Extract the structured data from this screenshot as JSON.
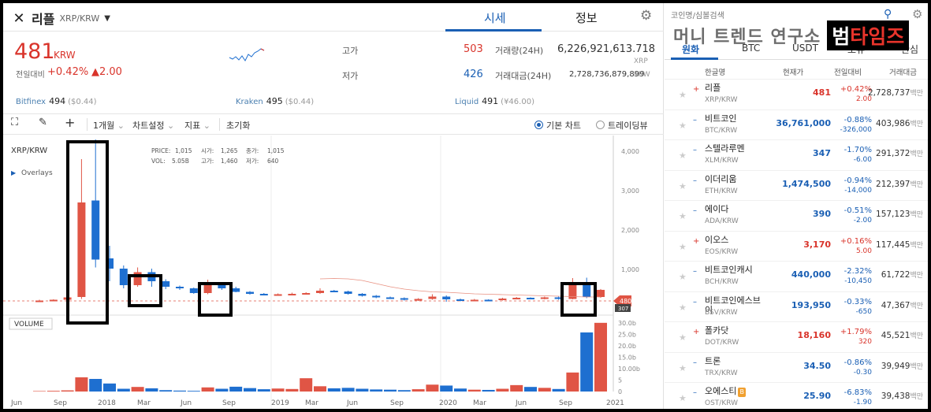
{
  "header": {
    "coin_kr": "리플",
    "pair": "XRP/KRW",
    "tab_market": "시세",
    "tab_info": "정보"
  },
  "price": {
    "current": "481",
    "unit": "KRW",
    "change_label": "전일대비",
    "change_pct": "+0.42%",
    "change_abs": "▲2.00",
    "high_label": "고가",
    "high": "503",
    "low_label": "저가",
    "low": "426",
    "volume_label": "거래량(24H)",
    "volume": "6,226,921,613.718",
    "volume_unit": "XRP",
    "amount_label": "거래대금(24H)",
    "amount": "2,728,736,879,899",
    "amount_unit": "KRW"
  },
  "exchanges": [
    {
      "name": "Bitfinex",
      "value": "494",
      "sub": "($0.44)"
    },
    {
      "name": "Kraken",
      "value": "495",
      "sub": "($0.44)"
    },
    {
      "name": "Liquid",
      "value": "491",
      "sub": "(¥46.00)"
    }
  ],
  "toolbar": {
    "period": "1개월",
    "chart_settings": "차트설정",
    "indicators": "지표",
    "reset": "초기화",
    "basic_chart": "기본 차트",
    "tradingview": "트레이딩뷰"
  },
  "chart_info": {
    "symbol": "XRP/KRW",
    "overlays": "Overlays",
    "price_label": "PRICE:",
    "price": "1,015",
    "open_label": "시가:",
    "open": "1,265",
    "close_label": "종가:",
    "close": "1,015",
    "vol_label": "VOL:",
    "vol": "5.05B",
    "high_label": "고가:",
    "high": "1,460",
    "low_label": "저가:",
    "low": "640",
    "volume_title": "VOLUME",
    "last_price_tag": "480",
    "last_price_sub": "307"
  },
  "chart_data": {
    "type": "candlestick",
    "x_ticks": [
      "Jun",
      "Sep",
      "2018",
      "Mar",
      "Jun",
      "Sep",
      "2019",
      "Mar",
      "Jun",
      "Sep",
      "2020",
      "Mar",
      "Jun",
      "Sep",
      "2021"
    ],
    "y_ticks": [
      "4,000",
      "3,000",
      "2,000",
      "1,000",
      "0"
    ],
    "ylim": [
      0,
      4400
    ],
    "vol_ticks": [
      "30.0b",
      "25.0b",
      "20.0b",
      "15.0b",
      "10.00b",
      "5",
      "0"
    ],
    "vol_lim": [
      0,
      32
    ],
    "up_color": "#e05545",
    "down_color": "#1e6fd0",
    "candles": [
      {
        "o": 200,
        "c": 210,
        "h": 230,
        "l": 190,
        "up": true,
        "v": 0.2
      },
      {
        "o": 210,
        "c": 230,
        "h": 240,
        "l": 200,
        "up": true,
        "v": 0.3
      },
      {
        "o": 230,
        "c": 290,
        "h": 320,
        "l": 215,
        "up": true,
        "v": 0.5
      },
      {
        "o": 300,
        "c": 2700,
        "h": 3800,
        "l": 250,
        "up": true,
        "v": 6.2
      },
      {
        "o": 2750,
        "c": 1250,
        "h": 4300,
        "l": 1050,
        "up": false,
        "v": 5.5
      },
      {
        "o": 1280,
        "c": 1020,
        "h": 1600,
        "l": 700,
        "up": false,
        "v": 3.5
      },
      {
        "o": 1020,
        "c": 600,
        "h": 1100,
        "l": 520,
        "up": false,
        "v": 1.2
      },
      {
        "o": 600,
        "c": 930,
        "h": 1050,
        "l": 560,
        "up": true,
        "v": 2.0
      },
      {
        "o": 930,
        "c": 700,
        "h": 1020,
        "l": 560,
        "up": false,
        "v": 1.4
      },
      {
        "o": 700,
        "c": 560,
        "h": 750,
        "l": 500,
        "up": false,
        "v": 0.6
      },
      {
        "o": 560,
        "c": 520,
        "h": 590,
        "l": 480,
        "up": false,
        "v": 0.4
      },
      {
        "o": 520,
        "c": 400,
        "h": 540,
        "l": 380,
        "up": false,
        "v": 0.3
      },
      {
        "o": 400,
        "c": 620,
        "h": 740,
        "l": 370,
        "up": true,
        "v": 1.8
      },
      {
        "o": 620,
        "c": 520,
        "h": 680,
        "l": 480,
        "up": false,
        "v": 1.2
      },
      {
        "o": 520,
        "c": 430,
        "h": 560,
        "l": 420,
        "up": false,
        "v": 2.1
      },
      {
        "o": 430,
        "c": 380,
        "h": 450,
        "l": 360,
        "up": false,
        "v": 1.5
      },
      {
        "o": 380,
        "c": 360,
        "h": 400,
        "l": 340,
        "up": false,
        "v": 1.0
      },
      {
        "o": 360,
        "c": 370,
        "h": 390,
        "l": 340,
        "up": true,
        "v": 1.3
      },
      {
        "o": 370,
        "c": 380,
        "h": 410,
        "l": 350,
        "up": true,
        "v": 1.1
      },
      {
        "o": 380,
        "c": 400,
        "h": 420,
        "l": 360,
        "up": true,
        "v": 5.8
      },
      {
        "o": 400,
        "c": 460,
        "h": 520,
        "l": 380,
        "up": true,
        "v": 2.3
      },
      {
        "o": 460,
        "c": 440,
        "h": 480,
        "l": 420,
        "up": false,
        "v": 1.4
      },
      {
        "o": 440,
        "c": 380,
        "h": 460,
        "l": 360,
        "up": false,
        "v": 1.6
      },
      {
        "o": 380,
        "c": 330,
        "h": 400,
        "l": 310,
        "up": false,
        "v": 1.2
      },
      {
        "o": 330,
        "c": 290,
        "h": 350,
        "l": 270,
        "up": false,
        "v": 0.9
      },
      {
        "o": 290,
        "c": 270,
        "h": 310,
        "l": 250,
        "up": false,
        "v": 0.8
      },
      {
        "o": 270,
        "c": 230,
        "h": 290,
        "l": 210,
        "up": false,
        "v": 0.6
      },
      {
        "o": 230,
        "c": 250,
        "h": 270,
        "l": 200,
        "up": true,
        "v": 1.0
      },
      {
        "o": 250,
        "c": 310,
        "h": 370,
        "l": 230,
        "up": true,
        "v": 3.0
      },
      {
        "o": 310,
        "c": 240,
        "h": 340,
        "l": 180,
        "up": false,
        "v": 2.6
      },
      {
        "o": 240,
        "c": 210,
        "h": 260,
        "l": 190,
        "up": false,
        "v": 1.3
      },
      {
        "o": 210,
        "c": 230,
        "h": 250,
        "l": 190,
        "up": true,
        "v": 0.8
      },
      {
        "o": 230,
        "c": 220,
        "h": 240,
        "l": 200,
        "up": false,
        "v": 0.7
      },
      {
        "o": 220,
        "c": 260,
        "h": 280,
        "l": 210,
        "up": true,
        "v": 1.2
      },
      {
        "o": 260,
        "c": 280,
        "h": 300,
        "l": 240,
        "up": true,
        "v": 2.8
      },
      {
        "o": 280,
        "c": 260,
        "h": 290,
        "l": 240,
        "up": false,
        "v": 2.0
      },
      {
        "o": 260,
        "c": 290,
        "h": 310,
        "l": 240,
        "up": true,
        "v": 1.6
      },
      {
        "o": 290,
        "c": 250,
        "h": 310,
        "l": 230,
        "up": false,
        "v": 1.1
      },
      {
        "o": 250,
        "c": 640,
        "h": 780,
        "l": 240,
        "up": true,
        "v": 8.3
      },
      {
        "o": 640,
        "c": 300,
        "h": 790,
        "l": 270,
        "up": false,
        "v": 25.8
      },
      {
        "o": 300,
        "c": 481,
        "h": 503,
        "l": 280,
        "up": true,
        "v": 30.0
      }
    ],
    "ma_line": [
      null,
      null,
      null,
      null,
      null,
      null,
      null,
      null,
      null,
      null,
      null,
      null,
      null,
      null,
      null,
      null,
      null,
      null,
      null,
      null,
      760,
      770,
      760,
      720,
      640,
      560,
      500,
      460,
      430,
      420,
      400,
      380,
      370,
      360,
      350,
      340,
      330,
      320,
      310,
      300,
      300
    ]
  },
  "right_panel": {
    "search_placeholder": "코인명/심볼검색",
    "tabs": [
      "원화",
      "BTC",
      "USDT",
      "보유",
      "관심"
    ],
    "headers": [
      "한글명",
      "현재가",
      "전일대비",
      "거래대금"
    ],
    "volume_unit": "백만",
    "rows": [
      {
        "name": "리플",
        "symbol": "XRP/KRW",
        "price": "481",
        "pct": "+0.42%",
        "diff": "2.00",
        "vol": "2,728,737",
        "dir": "up"
      },
      {
        "name": "비트코인",
        "symbol": "BTC/KRW",
        "price": "36,761,000",
        "pct": "-0.88%",
        "diff": "-326,000",
        "vol": "403,986",
        "dir": "dn"
      },
      {
        "name": "스텔라루멘",
        "symbol": "XLM/KRW",
        "price": "347",
        "pct": "-1.70%",
        "diff": "-6.00",
        "vol": "291,372",
        "dir": "dn"
      },
      {
        "name": "이더리움",
        "symbol": "ETH/KRW",
        "price": "1,474,500",
        "pct": "-0.94%",
        "diff": "-14,000",
        "vol": "212,397",
        "dir": "dn"
      },
      {
        "name": "에이다",
        "symbol": "ADA/KRW",
        "price": "390",
        "pct": "-0.51%",
        "diff": "-2.00",
        "vol": "157,123",
        "dir": "dn"
      },
      {
        "name": "이오스",
        "symbol": "EOS/KRW",
        "price": "3,170",
        "pct": "+0.16%",
        "diff": "5.00",
        "vol": "117,445",
        "dir": "up"
      },
      {
        "name": "비트코인캐시",
        "symbol": "BCH/KRW",
        "price": "440,000",
        "pct": "-2.32%",
        "diff": "-10,450",
        "vol": "61,722",
        "dir": "dn"
      },
      {
        "name": "비트코인에스브이",
        "symbol": "BSV/KRW",
        "price": "193,950",
        "pct": "-0.33%",
        "diff": "-650",
        "vol": "47,367",
        "dir": "dn"
      },
      {
        "name": "폴카닷",
        "symbol": "DOT/KRW",
        "price": "18,160",
        "pct": "+1.79%",
        "diff": "320",
        "vol": "45,521",
        "dir": "up"
      },
      {
        "name": "트론",
        "symbol": "TRX/KRW",
        "price": "34.50",
        "pct": "-0.86%",
        "diff": "-0.30",
        "vol": "39,949",
        "dir": "dn"
      },
      {
        "name": "오에스티",
        "symbol": "OST/KRW",
        "price": "25.90",
        "pct": "-6.83%",
        "diff": "-1.90",
        "vol": "39,438",
        "dir": "dn",
        "badge": "B"
      }
    ]
  },
  "watermark": {
    "text": "머니 트렌드 연구소",
    "logo_a": "범",
    "logo_b": "타임즈"
  },
  "colors": {
    "up": "#d9342b",
    "down": "#1a5fb4",
    "accent": "#1a5fb4"
  }
}
